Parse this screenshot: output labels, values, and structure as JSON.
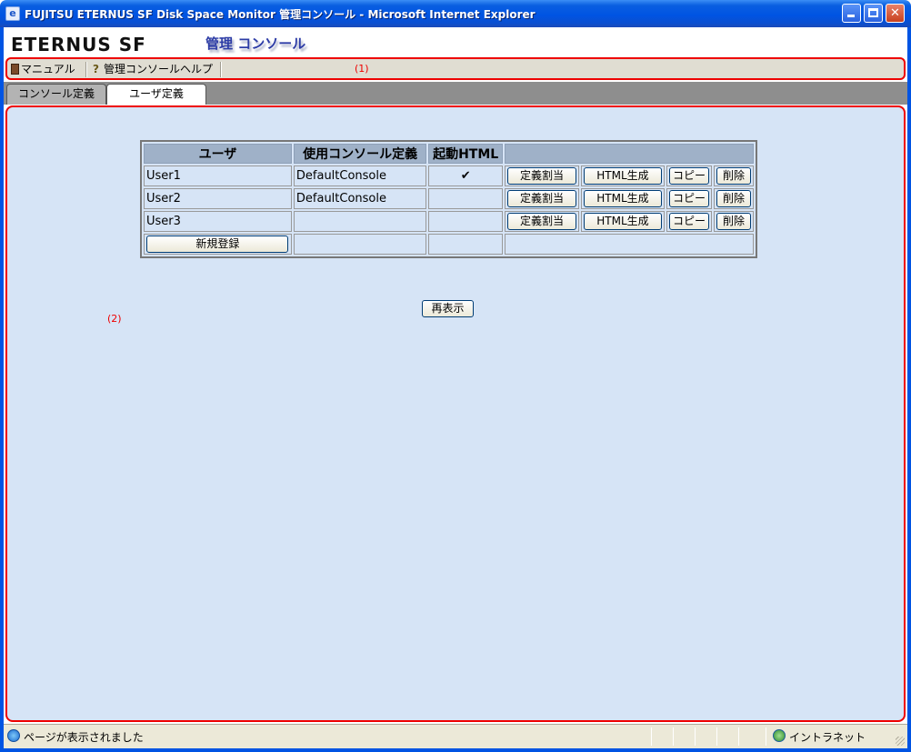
{
  "window": {
    "title": "FUJITSU ETERNUS SF Disk Space Monitor 管理コンソール - Microsoft Internet Explorer",
    "minimize": "minimize",
    "maximize": "maximize",
    "close": "✕"
  },
  "header": {
    "logo": "ETERNUS SF",
    "console_title": "管理 コンソール"
  },
  "toolbar": {
    "manual": "マニュアル",
    "help": "管理コンソールヘルプ",
    "marker": "(1)"
  },
  "tabs": [
    {
      "label": "コンソール定義"
    },
    {
      "label": "ユーザ定義"
    }
  ],
  "table": {
    "headers": [
      "ユーザ",
      "使用コンソール定義",
      "起動HTML",
      ""
    ],
    "rows": [
      {
        "user": "User1",
        "console": "DefaultConsole",
        "html": "✔"
      },
      {
        "user": "User2",
        "console": "DefaultConsole",
        "html": ""
      },
      {
        "user": "User3",
        "console": "",
        "html": ""
      }
    ],
    "row_buttons": {
      "assign": "定義割当",
      "html": "HTML生成",
      "copy": "コピー",
      "delete": "削除"
    },
    "new_button": "新規登録"
  },
  "refresh_button": "再表示",
  "content_marker": "(2)",
  "status": {
    "text": "ページが表示されました",
    "zone": "イントラネット"
  },
  "colors": {
    "title_bar": "#0054e3",
    "content_bg": "#d6e4f6",
    "highlight_border": "#ee0000",
    "table_header_bg": "#9fb1c8"
  }
}
